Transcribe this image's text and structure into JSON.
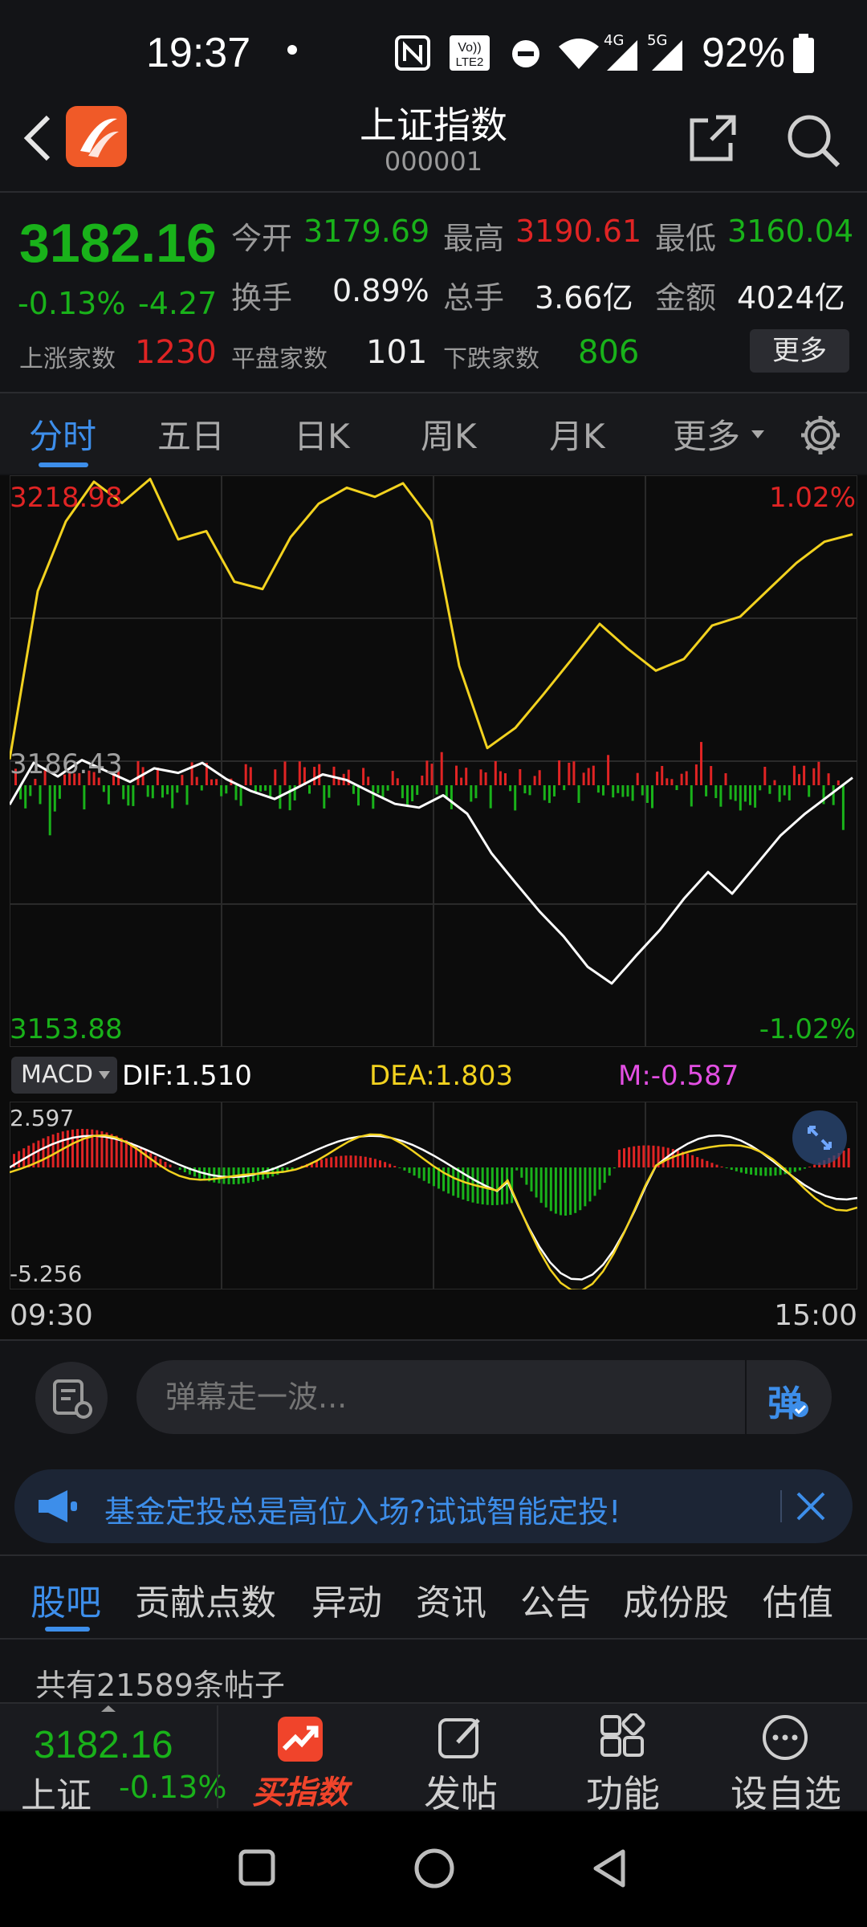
{
  "status_bar": {
    "time": "19:37",
    "battery": "92%",
    "network": [
      "4G",
      "5G"
    ],
    "icons": [
      "nfc-icon",
      "volte-icon",
      "dnd-icon",
      "wifi-icon",
      "signal-icon",
      "signal-icon",
      "battery-icon"
    ]
  },
  "header": {
    "title": "上证指数",
    "code": "000001"
  },
  "quote": {
    "price": "3182.16",
    "change_pct": "-0.13%",
    "change": "-4.27",
    "open_label": "今开",
    "open": "3179.69",
    "high_label": "最高",
    "high": "3190.61",
    "low_label": "最低",
    "low": "3160.04",
    "turnover_label": "换手",
    "turnover": "0.89%",
    "volume_label": "总手",
    "volume": "3.66亿",
    "amount_label": "金额",
    "amount": "4024亿",
    "up_label": "上涨家数",
    "up": "1230",
    "flat_label": "平盘家数",
    "flat": "101",
    "down_label": "下跌家数",
    "down": "806",
    "more_label": "更多"
  },
  "tabs": [
    "分时",
    "五日",
    "日K",
    "周K",
    "月K",
    "更多"
  ],
  "chart": {
    "top_left": "3218.98",
    "top_right": "1.02%",
    "mid_left": "3186.43",
    "bottom_left": "3153.88",
    "bottom_right": "-1.02%",
    "macd_select": "MACD",
    "dif": "DIF:1.510",
    "dea": "DEA:1.803",
    "m": "M:-0.587",
    "macd_top": "2.597",
    "macd_bottom": "-5.256",
    "time_start": "09:30",
    "time_end": "15:00",
    "colors": {
      "price": "#ffffff",
      "avg": "#f2d21f",
      "up": "#e02424",
      "down": "#19b21a",
      "dif": "#ffffff",
      "dea": "#f2d21f",
      "m": "#e34fe3"
    }
  },
  "chart_data": {
    "type": "line",
    "ylim": [
      3153.88,
      3218.98
    ],
    "series": [
      {
        "values": [
          3181.0,
          3186.0,
          3184.4,
          3186.2,
          3184.8,
          3183.5,
          3185.2,
          3184.8,
          3186.0,
          3184.0,
          3182.5,
          3181.5,
          3183.0,
          3184.6,
          3184.0,
          3182.5,
          3181.0,
          3180.5,
          3182.0,
          3180.0,
          3175.5,
          3172.0,
          3168.5,
          3165.5,
          3162.0,
          3160.2,
          3163.5,
          3166.5,
          3170.0,
          3173.0,
          3170.5,
          3174.0,
          3177.5,
          3180.0,
          3182.0,
          3184.0
        ]
      },
      {
        "values": [
          3186.4,
          3206.0,
          3214.0,
          3218.5,
          3216.0,
          3218.9,
          3212.0,
          3213.0,
          3207.0,
          3206.0,
          3212.0,
          3216.0,
          3218.0,
          3217.0,
          3218.5,
          3214.0,
          3197.0,
          3187.5,
          3190.0,
          3194.0,
          3198.0,
          3202.0,
          3199.0,
          3196.5,
          3198.0,
          3202.0,
          3203.0,
          3206.0,
          3209.0,
          3211.5,
          3212.5
        ]
      }
    ]
  },
  "chat": {
    "placeholder": "弹幕走一波...",
    "send": "弹"
  },
  "banner": {
    "text": "基金定投总是高位入场?试试智能定投!"
  },
  "sections": [
    "股吧",
    "贡献点数",
    "异动",
    "资讯",
    "公告",
    "成份股",
    "估值"
  ],
  "posts_count": "共有21589条帖子",
  "bottom_nav": {
    "price": "3182.16",
    "name": "上证",
    "pct": "-0.13%",
    "items": [
      "买指数",
      "发帖",
      "功能",
      "设自选"
    ]
  }
}
